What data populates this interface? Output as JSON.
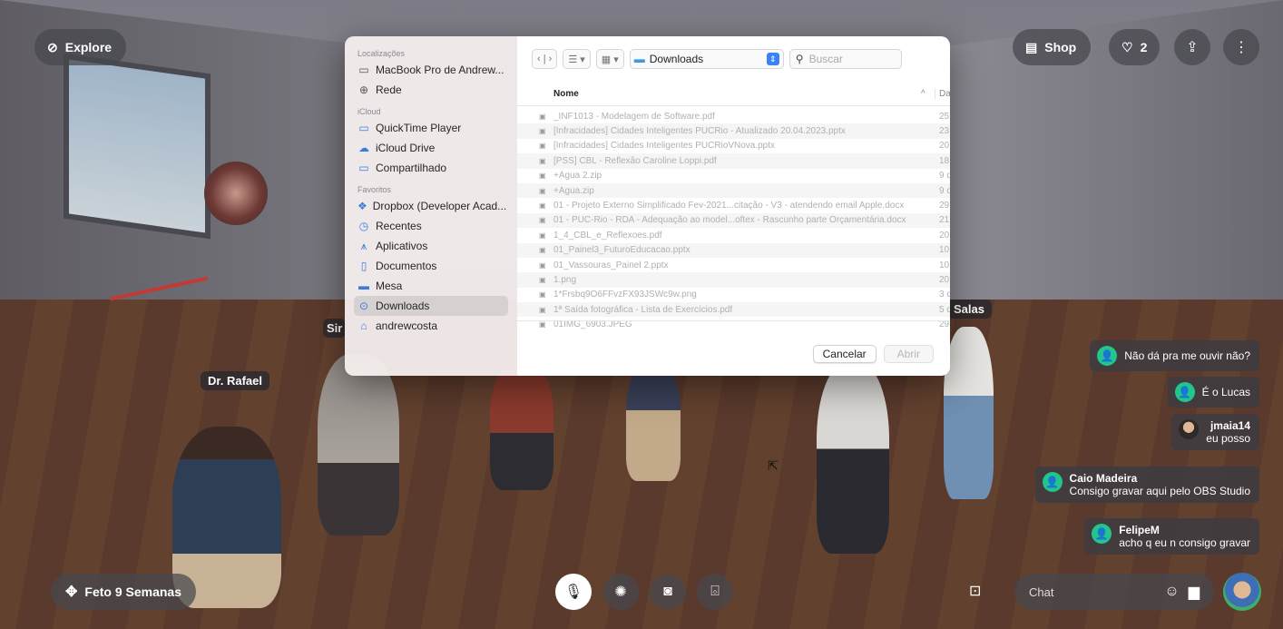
{
  "top_bar": {
    "explore_label": "Explore",
    "shop_label": "Shop",
    "favorites_count": "2"
  },
  "scene": {
    "name_tags": [
      "Dr. Rafael",
      "Sir",
      "Salas"
    ]
  },
  "file_dialog": {
    "sidebar": {
      "sections": [
        {
          "header": "Localizações",
          "items": [
            {
              "label": "MacBook Pro de Andrew...",
              "icon": "laptop-icon"
            },
            {
              "label": "Rede",
              "icon": "globe-icon"
            }
          ]
        },
        {
          "header": "iCloud",
          "items": [
            {
              "label": "QuickTime Player",
              "icon": "folder-icon"
            },
            {
              "label": "iCloud Drive",
              "icon": "cloud-icon"
            },
            {
              "label": "Compartilhado",
              "icon": "shared-folder-icon"
            }
          ]
        },
        {
          "header": "Favoritos",
          "items": [
            {
              "label": "Dropbox (Developer Acad...",
              "icon": "dropbox-icon"
            },
            {
              "label": "Recentes",
              "icon": "clock-icon"
            },
            {
              "label": "Aplicativos",
              "icon": "apps-icon"
            },
            {
              "label": "Documentos",
              "icon": "document-icon"
            },
            {
              "label": "Mesa",
              "icon": "desktop-icon"
            },
            {
              "label": "Downloads",
              "icon": "download-icon",
              "selected": true
            },
            {
              "label": "andrewcosta",
              "icon": "home-icon"
            }
          ]
        }
      ]
    },
    "toolbar": {
      "location": "Downloads",
      "search_placeholder": "Buscar"
    },
    "column_name": "Nome",
    "column_date_truncated": "Da",
    "files": [
      {
        "name": "_INF1013 - Modelagem de Software.pdf",
        "date": "25"
      },
      {
        "name": "[Infracidades] Cidades Inteligentes PUCRio - Atualizado 20.04.2023.pptx",
        "date": "23"
      },
      {
        "name": "[Infracidades] Cidades Inteligentes PUCRioVNova.pptx",
        "date": "20"
      },
      {
        "name": "[PSS] CBL - Reflexão Caroline Loppi.pdf",
        "date": "18"
      },
      {
        "name": "+Água 2.zip",
        "date": "9 d"
      },
      {
        "name": "+Água.zip",
        "date": "9 d"
      },
      {
        "name": "01 - Projeto Externo Simplificado Fev-2021...citação - V3 - atendendo email Apple.docx",
        "date": "29"
      },
      {
        "name": "01 - PUC-Rio - RDA - Adequação ao model...oftex - Rascunho parte Orçamentária.docx",
        "date": "21"
      },
      {
        "name": "1_4_CBL_e_Reflexoes.pdf",
        "date": "20"
      },
      {
        "name": "01_Painel3_FuturoEducacao.pptx",
        "date": "10"
      },
      {
        "name": "01_Vassouras_Painel 2.pptx",
        "date": "10"
      },
      {
        "name": "1.png",
        "date": "20"
      },
      {
        "name": "1*Frsbq9O6FFvzFX93JSWc9w.png",
        "date": "3 d"
      },
      {
        "name": "1ª Saída fotográfica - Lista de Exercícios.pdf",
        "date": "5 d"
      },
      {
        "name": "01IMG_6903.JPEG",
        "date": "29"
      }
    ],
    "cancel_label": "Cancelar",
    "open_label": "Abrir"
  },
  "chat_messages": [
    {
      "user": "",
      "text": "Não dá pra me ouvir não?",
      "avatar": "person-icon"
    },
    {
      "user": "",
      "text": "É o Lucas",
      "avatar": "person-icon"
    },
    {
      "user": "jmaia14",
      "text": "eu posso",
      "avatar": "photo"
    },
    {
      "user": "Caio Madeira",
      "text": "Consigo gravar aqui pelo OBS Studio",
      "avatar": "person-icon"
    },
    {
      "user": "FelipeM",
      "text": "acho q eu n consigo gravar",
      "avatar": "person-icon"
    }
  ],
  "bottom_bar": {
    "room_name": "Feto 9 Semanas",
    "chat_placeholder": "Chat"
  },
  "colors": {
    "accent_green": "#22c58b",
    "selected_blue": "#3b82f6"
  }
}
